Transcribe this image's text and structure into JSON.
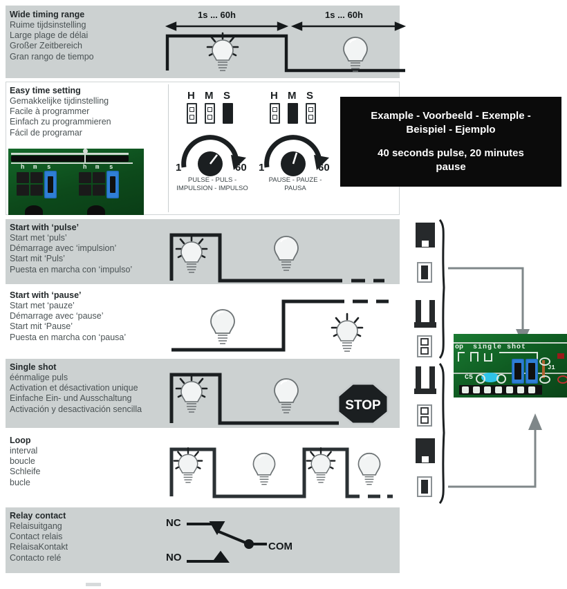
{
  "page": {
    "background": "#ffffff",
    "band_color": "#ccd1d1",
    "ink": "#23292b"
  },
  "sections": [
    {
      "id": "wide-timing-range",
      "shaded": true,
      "title": "Wide timing range",
      "lines": [
        "Ruime tijdsinstelling",
        "Large plage de délai",
        "Großer Zeitbereich",
        "Gran rango de tiempo"
      ],
      "diagram": {
        "type": "timing-waveform",
        "arrow_labels": [
          "1s ... 60h",
          "1s ... 60h"
        ],
        "lamps": [
          "on",
          "off"
        ]
      }
    },
    {
      "id": "easy-time-setting",
      "shaded": false,
      "title": "Easy time setting",
      "lines": [
        "Gemakkelijke tijdinstelling",
        "Facile à programmer",
        "Einfach zu programmieren",
        "Fácil de programar"
      ],
      "photo": {
        "name": "pcb-photo-dip-switches",
        "silk_labels": [
          "h",
          "m",
          "s",
          "h",
          "m",
          "s"
        ]
      }
    },
    {
      "id": "start-with-pulse",
      "shaded": true,
      "title": "Start with ‘pulse’",
      "lines": [
        "Start met ‘puls’",
        "Démarrage avec ‘impulsion’",
        "Start mit ‘Puls’",
        "Puesta en marcha con ‘impulso’"
      ],
      "diagram": {
        "type": "timing-waveform",
        "lamps": [
          "on",
          "off"
        ],
        "dashed_tail": true
      },
      "jumpers": [
        {
          "name": "jumper-closed-top",
          "state": "closed"
        },
        {
          "name": "jumper-single-filled",
          "state": "filled"
        }
      ]
    },
    {
      "id": "start-with-pause",
      "shaded": false,
      "title": "Start with ‘pause’",
      "lines": [
        "Start met ‘pauze’",
        "Démarrage avec ‘pause’",
        "Start mit ‘Pause’",
        "Puesta en marcha con ‘pausa’"
      ],
      "diagram": {
        "type": "timing-waveform",
        "lamps": [
          "off",
          "on"
        ],
        "dashed_tail": true
      },
      "jumpers": [
        {
          "name": "jumper-open-pins",
          "state": "open"
        },
        {
          "name": "jumper-two-empty",
          "state": "empty"
        }
      ]
    },
    {
      "id": "single-shot",
      "shaded": true,
      "title": "Single shot",
      "lines": [
        "éénmalige puls",
        "Activation et désactivation unique",
        "Einfache Ein- und Ausschaltung",
        "Activación y desactivación sencilla"
      ],
      "diagram": {
        "type": "timing-waveform",
        "lamps": [
          "on",
          "off"
        ],
        "stop_sign": "STOP"
      },
      "jumpers": [
        {
          "name": "jumper-open-pins",
          "state": "open"
        },
        {
          "name": "jumper-two-empty",
          "state": "empty"
        }
      ]
    },
    {
      "id": "loop",
      "shaded": false,
      "title": "Loop",
      "lines": [
        "interval",
        "boucle",
        "Schleife",
        "bucle"
      ],
      "diagram": {
        "type": "timing-waveform",
        "lamps": [
          "on",
          "off",
          "on",
          "off"
        ],
        "dashed_tail": true
      },
      "jumpers": [
        {
          "name": "jumper-closed-top",
          "state": "closed"
        },
        {
          "name": "jumper-single-filled",
          "state": "filled"
        }
      ]
    },
    {
      "id": "relay-contact",
      "shaded": true,
      "title": "Relay contact",
      "lines": [
        "Relaisuitgang",
        "Contact relais",
        "RelaisaKontakt",
        "Contacto relé"
      ],
      "diagram": {
        "type": "relay-schematic",
        "terminals": [
          "NC",
          "COM",
          "NO"
        ]
      }
    }
  ],
  "dials": [
    {
      "name": "pulse-dial",
      "switch_labels": [
        "H",
        "M",
        "S"
      ],
      "switch_states": [
        "off",
        "off",
        "on"
      ],
      "min": "1",
      "max": "60",
      "caption": "PULSE - PULS -\nIMPULSION - IMPULSO",
      "caption_line1": "PULSE - PULS -",
      "caption_line2": "IMPULSION - IMPULSO"
    },
    {
      "name": "pause-dial",
      "switch_labels": [
        "H",
        "M",
        "S"
      ],
      "switch_states": [
        "off",
        "on",
        "off"
      ],
      "min": "1",
      "max": "60",
      "caption_line1": "PAUSE - PAUZE -",
      "caption_line2": "PAUSA"
    }
  ],
  "example_box": {
    "name": "example-callout",
    "line1": "Example - Voorbeeld - Exemple -",
    "line2": "Beispiel - Ejemplo",
    "line3": "40 seconds pulse, 20 minutes",
    "line4": "pause",
    "bg": "#0b0b0b",
    "fg": "#ffffff"
  },
  "pcb_right": {
    "name": "pcb-photo-single-shot",
    "silk_text": "single shot",
    "silk_left": "op",
    "silk_c5": "C5",
    "silk_j1": "J1"
  },
  "stop_sign": {
    "label": "STOP"
  },
  "relay": {
    "nc": "NC",
    "com": "COM",
    "no": "NO"
  }
}
